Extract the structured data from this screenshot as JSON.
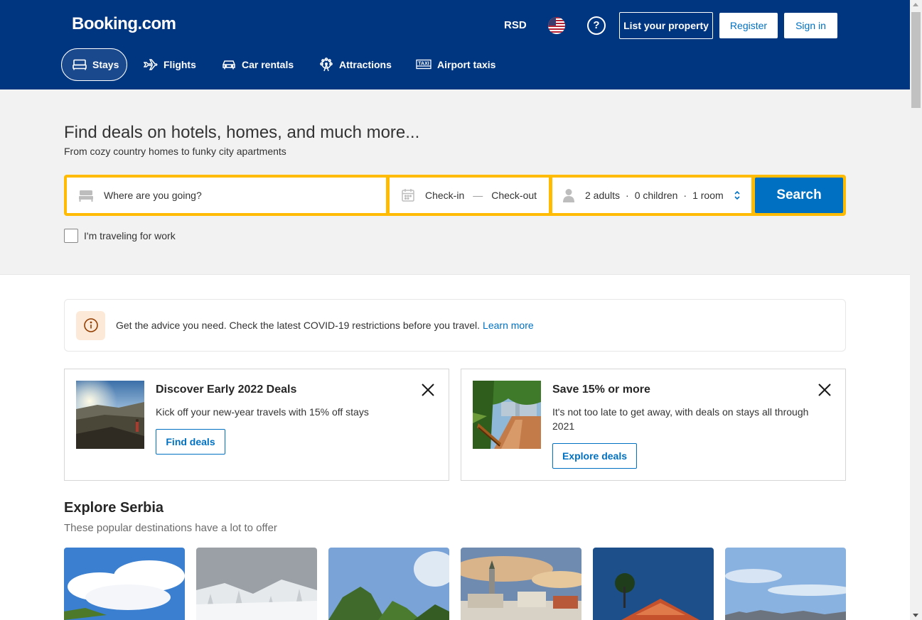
{
  "header": {
    "logo": "Booking.com",
    "currency": "RSD",
    "flag_icon": "us-flag-icon",
    "help_icon": "help-icon",
    "list_property": "List your property",
    "register": "Register",
    "sign_in": "Sign in"
  },
  "nav": [
    {
      "label": "Stays",
      "icon": "bed-icon",
      "active": true
    },
    {
      "label": "Flights",
      "icon": "plane-icon"
    },
    {
      "label": "Car rentals",
      "icon": "car-icon"
    },
    {
      "label": "Attractions",
      "icon": "ferris-wheel-icon"
    },
    {
      "label": "Airport taxis",
      "icon": "taxi-icon"
    }
  ],
  "hero": {
    "title": "Find deals on hotels, homes, and much more...",
    "subtitle": "From cozy country homes to funky city apartments"
  },
  "search": {
    "destination_placeholder": "Where are you going?",
    "check_in": "Check-in",
    "check_out": "Check-out",
    "dash": "—",
    "adults": "2 adults",
    "children": "0 children",
    "rooms": "1 room",
    "dot": "·",
    "button": "Search",
    "work_checkbox": "I'm traveling for work"
  },
  "covid": {
    "text": "Get the advice you need. Check the latest COVID-19 restrictions before you travel.",
    "link": "Learn more",
    "icon": "info-icon"
  },
  "promos": [
    {
      "title": "Discover Early 2022 Deals",
      "text": "Kick off your new-year travels with 15% off stays",
      "button": "Find deals"
    },
    {
      "title": "Save 15% or more",
      "text": "It's not too late to get away, with deals on stays all through 2021",
      "button": "Explore deals"
    }
  ],
  "explore": {
    "title": "Explore Serbia",
    "subtitle": "These popular destinations have a lot to offer"
  },
  "colors": {
    "brand_blue": "#003580",
    "accent_blue": "#0071c2",
    "search_border": "#febb02"
  }
}
